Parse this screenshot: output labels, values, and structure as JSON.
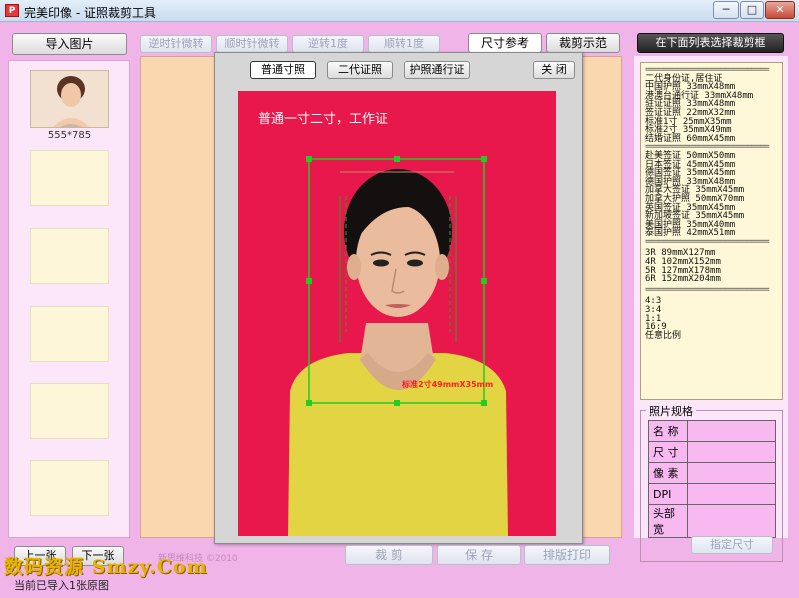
{
  "window": {
    "title": "完美印像 - 证照裁剪工具",
    "icon_letter": "P",
    "minimize": "─",
    "maximize": "□",
    "close": "✕"
  },
  "colors": {
    "background": "#f0b4e8",
    "photo_red": "#e8174c",
    "crop_green": "#22cc22",
    "label_red": "#ff2020"
  },
  "toolbar": {
    "import_btn": "导入图片",
    "rotate_buttons": [
      "逆时针微转",
      "顺时针微转",
      "逆转1度",
      "顺转1度"
    ],
    "tab_size": "尺寸参考",
    "tab_crop": "裁剪示范",
    "select_hint": "在下面列表选择裁剪框"
  },
  "thumbnail": {
    "dimensions": "555*785"
  },
  "dialog": {
    "buttons": [
      "普通寸照",
      "二代证照",
      "护照通行证"
    ],
    "close": "关 闭",
    "photo_caption": "普通一寸二寸，工作证",
    "crop_label": "标准2寸49mmX35mm"
  },
  "specs": {
    "separator": "============================",
    "group1": [
      "二代身份证,居住证",
      "中国护照      33mmX48mm",
      "港澳台通行证  33mmX48mm",
      "驻证证照      33mmX48mm",
      "签证证照      22mmX32mm",
      "标准1寸       25mmX35mm",
      "标准2寸       35mmX49mm",
      "结婚证照      60mmX45mm"
    ],
    "group2": [
      "赴美签证      50mmX50mm",
      "日本签证      45mmX45mm",
      "德国签证      35mmX45mm",
      "德国护照      33mmX48mm",
      "加拿大签证    35mmX45mm",
      "加拿大护照    50mmX70mm",
      "英国签证      35mmX45mm",
      "新加坡签证    35mmX45mm",
      "美国护照      35mmX40mm",
      "泰国护照      42mmX51mm"
    ],
    "group3": [
      "3R  89mmX127mm",
      "4R  102mmX152mm",
      "5R  127mmX178mm",
      "6R  152mmX204mm"
    ],
    "group4": [
      "4:3",
      "3:4",
      "1:1",
      "16:9",
      "任意比例"
    ]
  },
  "photo_spec": {
    "title": "照片规格",
    "rows": [
      "名 称",
      "尺 寸",
      "像 素",
      "DPI",
      "头部宽"
    ],
    "apply_btn": "指定尺寸"
  },
  "bottom": {
    "crop_btn": "裁 剪",
    "save_btn": "保 存",
    "print_btn": "排版打印",
    "copyright": "新思维科技 ©2010",
    "status": "当前已导入1张原图",
    "left_btn1": "上一张",
    "left_btn2": "下一张",
    "watermark": "数码资源 Smzy.Com"
  }
}
